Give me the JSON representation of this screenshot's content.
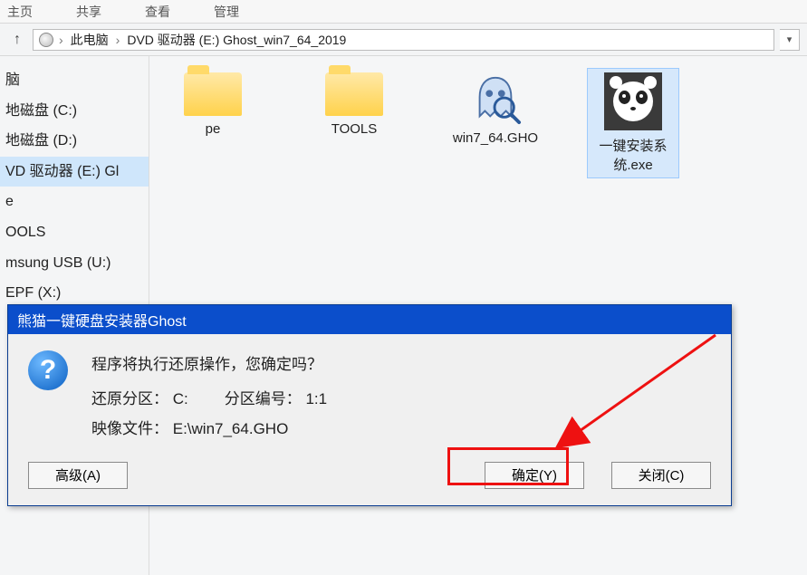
{
  "ribbon": {
    "tab1": "主页",
    "tab2": "共享",
    "tab3": "查看",
    "tab4": "管理"
  },
  "address": {
    "root": "此电脑",
    "drive": "DVD 驱动器 (E:) Ghost_win7_64_2019"
  },
  "sidebar": {
    "items": [
      "脑",
      "地磁盘 (C:)",
      "地磁盘 (D:)",
      "VD 驱动器 (E:) Gl",
      "e",
      "OOLS",
      "msung USB (U:)",
      "EPF (X:)"
    ]
  },
  "files": [
    {
      "name": "pe",
      "kind": "folder"
    },
    {
      "name": "TOOLS",
      "kind": "folder"
    },
    {
      "name": "win7_64.GHO",
      "kind": "gho"
    },
    {
      "name": "一键安装系统.exe",
      "kind": "panda"
    }
  ],
  "dialog": {
    "title": "熊猫一键硬盘安装器Ghost",
    "message": "程序将执行还原操作，您确定吗？",
    "partition_label": "还原分区：",
    "partition_value": "C:",
    "partno_label": "分区编号：",
    "partno_value": "1:1",
    "image_label": "映像文件：",
    "image_value": "E:\\win7_64.GHO",
    "btn_adv": "高级(A)",
    "btn_ok": "确定(Y)",
    "btn_close": "关闭(C)"
  }
}
